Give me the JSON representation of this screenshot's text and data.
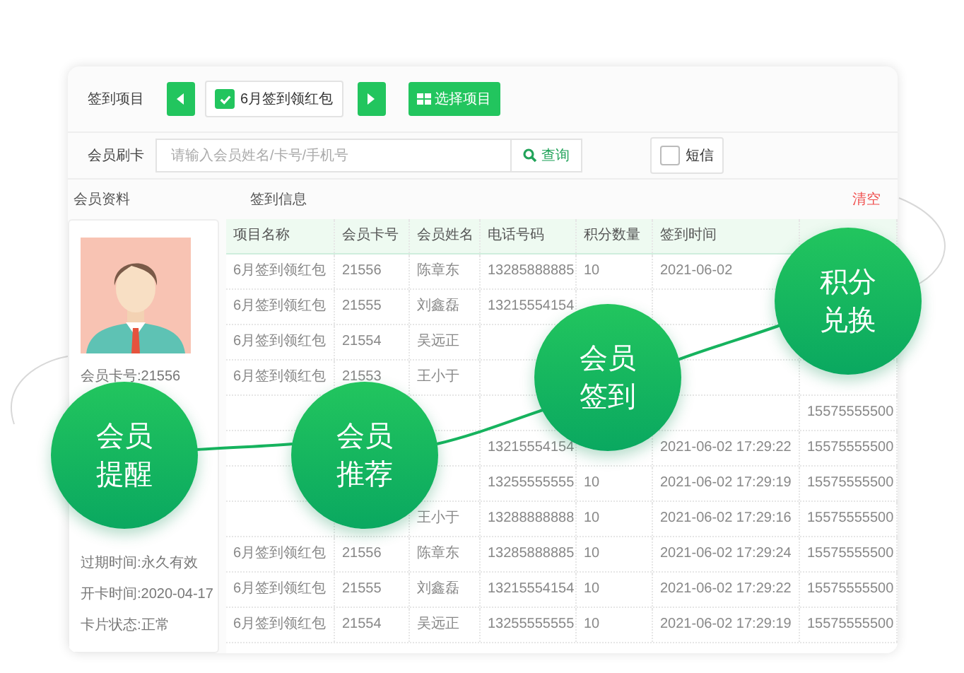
{
  "toolbar": {
    "label": "签到项目",
    "project": {
      "label": "6月签到领红包",
      "checked": true
    },
    "select_button": "选择项目"
  },
  "search": {
    "label": "会员刷卡",
    "placeholder": "请输入会员姓名/卡号/手机号",
    "button": "查询",
    "sms": {
      "label": "短信",
      "checked": false
    }
  },
  "sections": {
    "profile": "会员资料",
    "signin": "签到信息",
    "clear": "清空"
  },
  "profile": {
    "top_fields": [
      "会员卡号:21556"
    ],
    "bottom_fields": [
      "过期时间:永久有效",
      "开卡时间:2020-04-17",
      "卡片状态:正常"
    ]
  },
  "table": {
    "columns": [
      "项目名称",
      "会员卡号",
      "会员姓名",
      "电话号码",
      "积分数量",
      "签到时间",
      null
    ],
    "rows": [
      [
        "6月签到领红包",
        "21556",
        "陈章东",
        "13285888885",
        "10",
        "2021-06-02",
        null
      ],
      [
        "6月签到领红包",
        "21555",
        "刘鑫磊",
        "13215554154",
        null,
        null,
        null
      ],
      [
        "6月签到领红包",
        "21554",
        "吴远正",
        null,
        null,
        null,
        null
      ],
      [
        "6月签到领红包",
        "21553",
        "王小于",
        null,
        null,
        null,
        null
      ],
      [
        null,
        null,
        null,
        null,
        null,
        null,
        "15575555500"
      ],
      [
        null,
        null,
        null,
        "13215554154",
        null,
        "2021-06-02 17:29:22",
        "15575555500"
      ],
      [
        null,
        null,
        null,
        "13255555555",
        "10",
        "2021-06-02 17:29:19",
        "15575555500"
      ],
      [
        null,
        null,
        "王小于",
        "13288888888",
        "10",
        "2021-06-02 17:29:16",
        "15575555500"
      ],
      [
        "6月签到领红包",
        "21556",
        "陈章东",
        "13285888885",
        "10",
        "2021-06-02 17:29:24",
        "15575555500"
      ],
      [
        "6月签到领红包",
        "21555",
        "刘鑫磊",
        "13215554154",
        "10",
        "2021-06-02 17:29:22",
        "15575555500"
      ],
      [
        "6月签到领红包",
        "21554",
        "吴远正",
        "13255555555",
        "10",
        "2021-06-02 17:29:19",
        "15575555500"
      ]
    ]
  },
  "features": [
    {
      "lines": [
        "会员",
        "提醒"
      ]
    },
    {
      "lines": [
        "会员",
        "推荐"
      ]
    },
    {
      "lines": [
        "会员",
        "签到"
      ]
    },
    {
      "lines": [
        "积分",
        "兑换"
      ]
    }
  ]
}
